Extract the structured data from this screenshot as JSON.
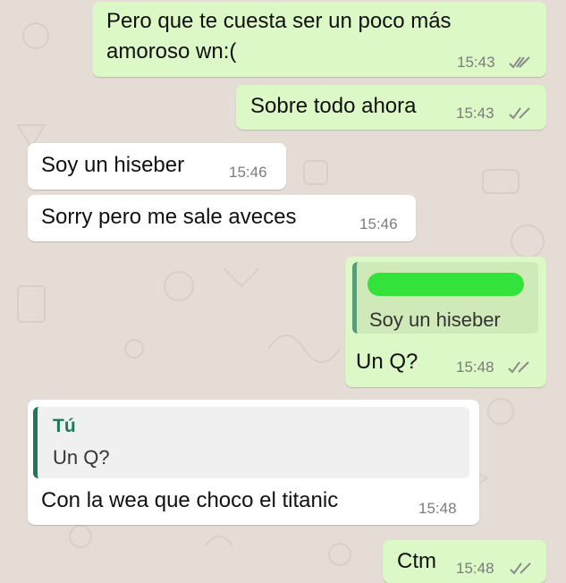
{
  "chat": {
    "messages": [
      {
        "line1": "Pero que te cuesta ser un poco más",
        "line2": "amoroso wn:(",
        "time": "15:43"
      },
      {
        "text": "Sobre todo ahora",
        "time": "15:43"
      },
      {
        "text": "Soy un hiseber",
        "time": "15:46"
      },
      {
        "text": "Sorry pero me sale aveces",
        "time": "15:46"
      },
      {
        "quoted_text": "Soy un hiseber",
        "text": "Un Q?",
        "time": "15:48"
      },
      {
        "quoted_author": "Tú",
        "quoted_text": "Un Q?",
        "text": "Con la wea que  choco el titanic",
        "time": "15:48"
      },
      {
        "text": "Ctm",
        "time": "15:48"
      }
    ]
  },
  "colors": {
    "outgoing_bubble": "#dcf8c6",
    "incoming_bubble": "#ffffff",
    "background": "#e5ddd5",
    "read_ticks": "#8a8a8a",
    "quote_author": "#1f7a5a",
    "redaction": "#34e23c"
  },
  "icons": {
    "read_receipt": "double-check-icon"
  }
}
